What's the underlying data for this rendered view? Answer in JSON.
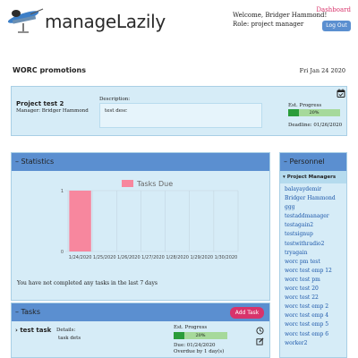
{
  "header": {
    "brand": "manageLazily",
    "welcome": "Welcome, Bridger Hammond!",
    "role": "Role: project manager",
    "dashboard_link": "Dashboard",
    "logout_label": "Log Out"
  },
  "org": {
    "title": "WORC promotions",
    "date": "Fri Jan 24 2020"
  },
  "project": {
    "name": "Project test 2",
    "manager": "Manager: Bridger Hammond",
    "description_label": "Description:",
    "description": "test desc",
    "est_progress_label": "Est. Progress",
    "progress": 0.2,
    "progress_text": "20%",
    "deadline": "Deadline: 01/26/2020",
    "icons": {
      "calendar": "calendar-icon"
    }
  },
  "statistics": {
    "heading": "Statistics",
    "message": "You have not completed any tasks in the last 7 days"
  },
  "chart_data": {
    "type": "bar",
    "legend": "Tasks Due",
    "legend_placement": "top-center",
    "categories": [
      "1/24/2020",
      "1/25/2020",
      "1/26/2020",
      "1/27/2020",
      "1/28/2020",
      "1/29/2020",
      "1/30/2020"
    ],
    "values": [
      1,
      0,
      0,
      0,
      0,
      0,
      0
    ],
    "ylim": [
      0,
      1
    ],
    "yticks": [
      "0",
      "1"
    ],
    "grid": true,
    "bar_color": "#f7879e"
  },
  "tasks": {
    "heading": "Tasks",
    "add_label": "Add Task",
    "items": [
      {
        "name": "test task",
        "details_label": "Details:",
        "details": "task dets",
        "est_progress_label": "Est. Progress",
        "progress": 0.2,
        "progress_text": "20%",
        "due": "Due: 01/24/2020",
        "overdue": "Overdue by 1 day(s)"
      }
    ]
  },
  "personnel": {
    "heading": "Personnel",
    "managers_heading": "Project Managers",
    "people": [
      "balayaydemir",
      "Bridger Hammond",
      "ggg",
      "testaddmanager",
      "testagain2",
      "testsignup",
      "testwithradio2",
      "tryagain",
      "worc pm test",
      "worc test emp 12",
      "worc test pm",
      "worc test 20",
      "worc test 22",
      "worc test emp 2",
      "worc test emp 4",
      "worc test emp 5",
      "worc test emp 6",
      "worker2"
    ]
  },
  "colors": {
    "accent": "#5b8fd0",
    "panel": "#d6ecf7",
    "pink": "#d8336b",
    "progress": "#2a9c3a",
    "link": "#1a55a8"
  }
}
